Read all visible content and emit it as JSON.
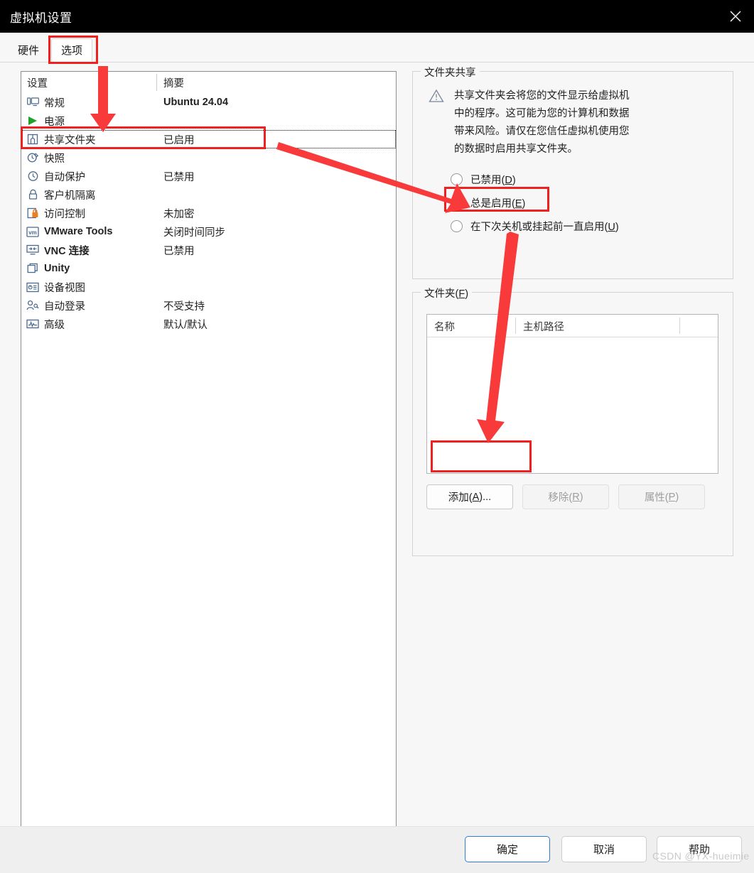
{
  "window": {
    "title": "虚拟机设置",
    "close_icon": "close-icon"
  },
  "tabs": [
    {
      "label": "硬件",
      "active": false
    },
    {
      "label": "选项",
      "active": true
    }
  ],
  "settings_list": {
    "headers": {
      "name": "设置",
      "summary": "摘要"
    },
    "rows": [
      {
        "icon": "monitor-icon",
        "label": "常规",
        "summary": "Ubuntu 24.04",
        "bold": true,
        "selected": false
      },
      {
        "icon": "play-icon",
        "label": "电源",
        "summary": "",
        "bold": false,
        "selected": false
      },
      {
        "icon": "shared-folder-icon",
        "label": "共享文件夹",
        "summary": "已启用",
        "bold": false,
        "selected": true
      },
      {
        "icon": "snapshot-icon",
        "label": "快照",
        "summary": "",
        "bold": false,
        "selected": false
      },
      {
        "icon": "autoprotect-icon",
        "label": "自动保护",
        "summary": "已禁用",
        "bold": false,
        "selected": false
      },
      {
        "icon": "lock-icon",
        "label": "客户机隔离",
        "summary": "",
        "bold": false,
        "selected": false
      },
      {
        "icon": "access-control-icon",
        "label": "访问控制",
        "summary": "未加密",
        "bold": false,
        "selected": false
      },
      {
        "icon": "vmware-tools-icon",
        "label": "VMware Tools",
        "summary": "关闭时间同步",
        "bold": true,
        "selected": false
      },
      {
        "icon": "vnc-icon",
        "label": "VNC 连接",
        "summary": "已禁用",
        "bold": true,
        "selected": false
      },
      {
        "icon": "unity-icon",
        "label": "Unity",
        "summary": "",
        "bold": true,
        "selected": false
      },
      {
        "icon": "device-view-icon",
        "label": "设备视图",
        "summary": "",
        "bold": false,
        "selected": false
      },
      {
        "icon": "auto-login-icon",
        "label": "自动登录",
        "summary": "不受支持",
        "bold": false,
        "selected": false
      },
      {
        "icon": "advanced-icon",
        "label": "高级",
        "summary": "默认/默认",
        "bold": false,
        "selected": false
      }
    ]
  },
  "folder_sharing": {
    "group_title": "文件夹共享",
    "warning_icon": "warning-triangle-icon",
    "warning_lines": [
      "共享文件夹会将您的文件显示给虚拟机",
      "中的程序。这可能为您的计算机和数据",
      "带来风险。请仅在您信任虚拟机使用您",
      "的数据时启用共享文件夹。"
    ],
    "options": [
      {
        "label": "已禁用(D)",
        "mnemonic": "D",
        "text_before": "已禁用(",
        "text_after": ")",
        "checked": false
      },
      {
        "label": "总是启用(E)",
        "mnemonic": "E",
        "text_before": "总是启用(",
        "text_after": ")",
        "checked": true
      },
      {
        "label": "在下次关机或挂起前一直启用(U)",
        "mnemonic": "U",
        "text_before": "在下次关机或挂起前一直启用(",
        "text_after": ")",
        "checked": false
      }
    ]
  },
  "folders": {
    "group_title_before": "文件夹(",
    "group_title_mnemonic": "F",
    "group_title_after": ")",
    "columns": [
      "名称",
      "主机路径"
    ],
    "rows": [],
    "buttons": [
      {
        "text_before": "添加(",
        "mnemonic": "A",
        "text_after": ")...",
        "enabled": true
      },
      {
        "text_before": "移除(",
        "mnemonic": "R",
        "text_after": ")",
        "enabled": false
      },
      {
        "text_before": "属性(",
        "mnemonic": "P",
        "text_after": ")",
        "enabled": false
      }
    ]
  },
  "footer": {
    "ok": "确定",
    "cancel": "取消",
    "help": "帮助"
  },
  "watermark": "CSDN @YX-hueimie",
  "colors": {
    "annotation_red": "#ef2020",
    "radio_blue": "#0a66c2",
    "title_bar": "#000000",
    "default_button_border": "#2f7fd0"
  }
}
